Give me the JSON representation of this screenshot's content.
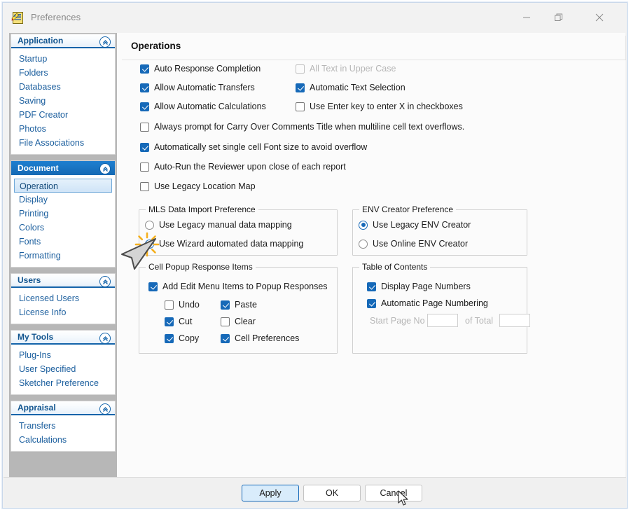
{
  "window": {
    "title": "Preferences",
    "icon": "preferences-document-icon",
    "controls": {
      "minimize": "minimize-icon",
      "maximize": "restore-icon",
      "close": "close-icon"
    }
  },
  "sidebar": {
    "groups": [
      {
        "header": "Application",
        "state": "expanded",
        "active": false,
        "items": [
          {
            "label": "Startup",
            "selected": false
          },
          {
            "label": "Folders",
            "selected": false
          },
          {
            "label": "Databases",
            "selected": false
          },
          {
            "label": "Saving",
            "selected": false
          },
          {
            "label": "PDF Creator",
            "selected": false
          },
          {
            "label": "Photos",
            "selected": false
          },
          {
            "label": "File Associations",
            "selected": false
          }
        ]
      },
      {
        "header": "Document",
        "state": "expanded",
        "active": true,
        "items": [
          {
            "label": "Operation",
            "selected": true
          },
          {
            "label": "Display",
            "selected": false
          },
          {
            "label": "Printing",
            "selected": false
          },
          {
            "label": "Colors",
            "selected": false
          },
          {
            "label": "Fonts",
            "selected": false
          },
          {
            "label": "Formatting",
            "selected": false
          }
        ]
      },
      {
        "header": "Users",
        "state": "expanded",
        "active": false,
        "items": [
          {
            "label": "Licensed Users",
            "selected": false
          },
          {
            "label": "License Info",
            "selected": false
          }
        ]
      },
      {
        "header": "My Tools",
        "state": "expanded",
        "active": false,
        "items": [
          {
            "label": "Plug-Ins",
            "selected": false
          },
          {
            "label": "User Specified",
            "selected": false
          },
          {
            "label": "Sketcher Preference",
            "selected": false
          }
        ]
      },
      {
        "header": "Appraisal",
        "state": "expanded",
        "active": false,
        "items": [
          {
            "label": "Transfers",
            "selected": false
          },
          {
            "label": "Calculations",
            "selected": false
          }
        ]
      }
    ]
  },
  "main": {
    "page_title": "Operations",
    "checkboxes": {
      "auto_response_completion": {
        "label": "Auto Response Completion",
        "checked": true,
        "disabled": false
      },
      "all_text_upper_case": {
        "label": "All Text in Upper Case",
        "checked": false,
        "disabled": true
      },
      "allow_automatic_transfers": {
        "label": "Allow Automatic Transfers",
        "checked": true,
        "disabled": false
      },
      "automatic_text_selection": {
        "label": "Automatic Text Selection",
        "checked": true,
        "disabled": false
      },
      "allow_automatic_calculations": {
        "label": "Allow Automatic Calculations",
        "checked": true,
        "disabled": false
      },
      "use_enter_key": {
        "label": "Use Enter key to enter X in checkboxes",
        "checked": false,
        "disabled": false
      },
      "always_prompt_carry_over": {
        "label": "Always prompt for Carry Over Comments Title when multiline cell text overflows.",
        "checked": false,
        "disabled": false
      },
      "auto_font_size": {
        "label": "Automatically set single cell Font size to avoid overflow",
        "checked": true,
        "disabled": false
      },
      "auto_run_reviewer": {
        "label": "Auto-Run the Reviewer upon close of each report",
        "checked": false,
        "disabled": false
      },
      "use_legacy_location_map": {
        "label": "Use Legacy Location Map",
        "checked": false,
        "disabled": false
      }
    },
    "mls_group": {
      "title": "MLS Data Import Preference",
      "options": [
        {
          "label": "Use Legacy manual data mapping",
          "selected": false
        },
        {
          "label": "Use Wizard automated data mapping",
          "selected": true
        }
      ]
    },
    "env_group": {
      "title": "ENV Creator Preference",
      "options": [
        {
          "label": "Use Legacy ENV Creator",
          "selected": true
        },
        {
          "label": "Use Online ENV Creator",
          "selected": false
        }
      ]
    },
    "cell_popup_group": {
      "title": "Cell Popup Response Items",
      "master": {
        "label": "Add Edit Menu Items to Popup Responses",
        "checked": true
      },
      "left_items": [
        {
          "label": "Undo",
          "checked": false
        },
        {
          "label": "Cut",
          "checked": true
        },
        {
          "label": "Copy",
          "checked": true
        }
      ],
      "right_items": [
        {
          "label": "Paste",
          "checked": false
        },
        {
          "label": "Clear",
          "checked": false
        },
        {
          "label": "Cell Preferences",
          "checked": true
        }
      ]
    },
    "toc_group": {
      "title": "Table of Contents",
      "display_page_numbers": {
        "label": "Display Page Numbers",
        "checked": true
      },
      "automatic_page_numbering": {
        "label": "Automatic Page Numbering",
        "checked": true
      },
      "start_page_label": "Start Page No",
      "start_page_value": "",
      "of_total_label": "of Total",
      "of_total_value": ""
    }
  },
  "footer": {
    "apply": "Apply",
    "ok": "OK",
    "cancel": "Cancel"
  },
  "colors": {
    "accent_blue": "#1669b8",
    "header_blue": "#1e7fd0",
    "link_blue": "#1c5f9e",
    "click_burst": "#f5b01e"
  }
}
